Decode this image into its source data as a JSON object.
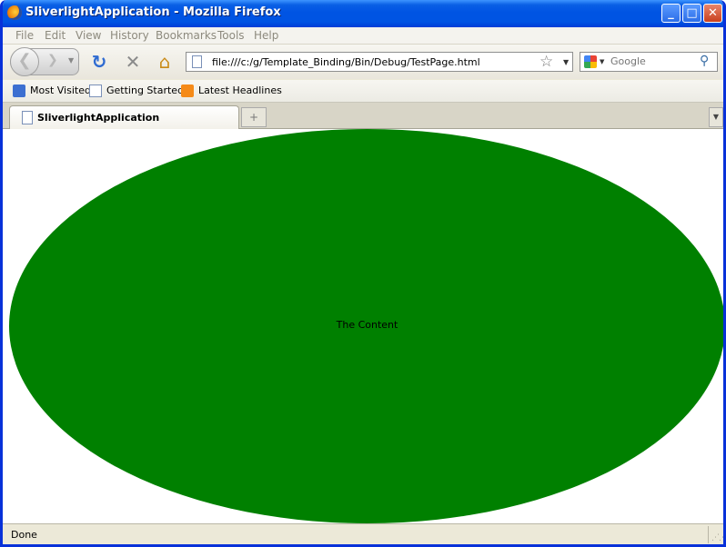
{
  "window": {
    "title": "SliverlightApplication - Mozilla Firefox",
    "controls": {
      "minimize": "_",
      "maximize": "□",
      "close": "✕"
    }
  },
  "menu": [
    "File",
    "Edit",
    "View",
    "History",
    "Bookmarks",
    "Tools",
    "Help"
  ],
  "navigation": {
    "address": "file:///c:/g/Template_Binding/Bin/Debug/TestPage.html",
    "search_placeholder": "Google",
    "icons": [
      "back-icon",
      "forward-icon",
      "reload-icon",
      "stop-icon",
      "home-icon",
      "bookmark-star-icon",
      "search-icon"
    ]
  },
  "bookmarks": [
    "Most Visited",
    "Getting Started",
    "Latest Headlines"
  ],
  "tabs": [
    {
      "label": "SliverlightApplication",
      "active": true
    }
  ],
  "content": {
    "shape": "ellipse",
    "fill_color": "#008000",
    "text": "The Content"
  },
  "status": {
    "text": "Done"
  },
  "colors": {
    "titlebar": "#0054e3",
    "accent": "#0831d9"
  }
}
